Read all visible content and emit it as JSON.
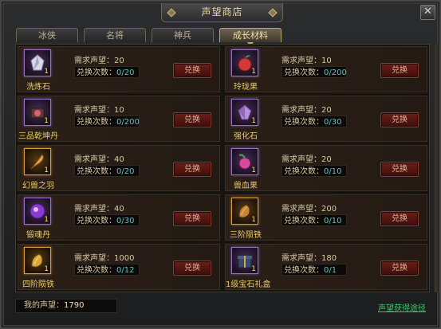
{
  "window": {
    "title": "声望商店",
    "close_label": "✕"
  },
  "tabs": [
    {
      "label": "冰侠",
      "active": false
    },
    {
      "label": "名将",
      "active": false
    },
    {
      "label": "神兵",
      "active": false
    },
    {
      "label": "成长材料",
      "active": true
    }
  ],
  "labels": {
    "req_prefix": "需求声望：",
    "exch_prefix": "兑换次数：",
    "exchange_button": "兑换"
  },
  "items": [
    {
      "name": "洗炼石",
      "icon": "crystal-ore-icon",
      "count": "1",
      "frame": "purple",
      "req": "20",
      "exch": "0/20"
    },
    {
      "name": "玲珑果",
      "icon": "red-fruit-icon",
      "count": "1",
      "frame": "purple",
      "req": "10",
      "exch": "0/200"
    },
    {
      "name": "三品乾坤丹",
      "icon": "pill-icon",
      "count": "1",
      "frame": "purple",
      "req": "10",
      "exch": "0/200"
    },
    {
      "name": "强化石",
      "icon": "strengthen-stone-icon",
      "count": "1",
      "frame": "purple",
      "req": "20",
      "exch": "0/30"
    },
    {
      "name": "幻兽之羽",
      "icon": "feather-icon",
      "count": "1",
      "frame": "gold",
      "req": "40",
      "exch": "0/20"
    },
    {
      "name": "兽血果",
      "icon": "blood-fruit-icon",
      "count": "1",
      "frame": "purple",
      "req": "20",
      "exch": "0/10"
    },
    {
      "name": "锻魂丹",
      "icon": "soul-orb-icon",
      "count": "1",
      "frame": "purple",
      "req": "40",
      "exch": "0/30"
    },
    {
      "name": "三阶陨铁",
      "icon": "meteor-iron-icon",
      "count": "1",
      "frame": "gold",
      "req": "200",
      "exch": "0/10"
    },
    {
      "name": "四阶陨铁",
      "icon": "meteor-iron-gold-icon",
      "count": "1",
      "frame": "gold",
      "req": "1000",
      "exch": "0/12"
    },
    {
      "name": "1级宝石礼盒",
      "icon": "gem-giftbox-icon",
      "count": "1",
      "frame": "purple",
      "req": "180",
      "exch": "0/1"
    }
  ],
  "footer": {
    "my_rep_label": "我的声望：",
    "my_rep_value": "1790",
    "rep_link": "声望获得途径"
  },
  "colors": {
    "accent_gold": "#e9c96a",
    "count_teal": "#52c7c7",
    "link_green": "#3fc26a",
    "button_red": "#6b1e19"
  }
}
